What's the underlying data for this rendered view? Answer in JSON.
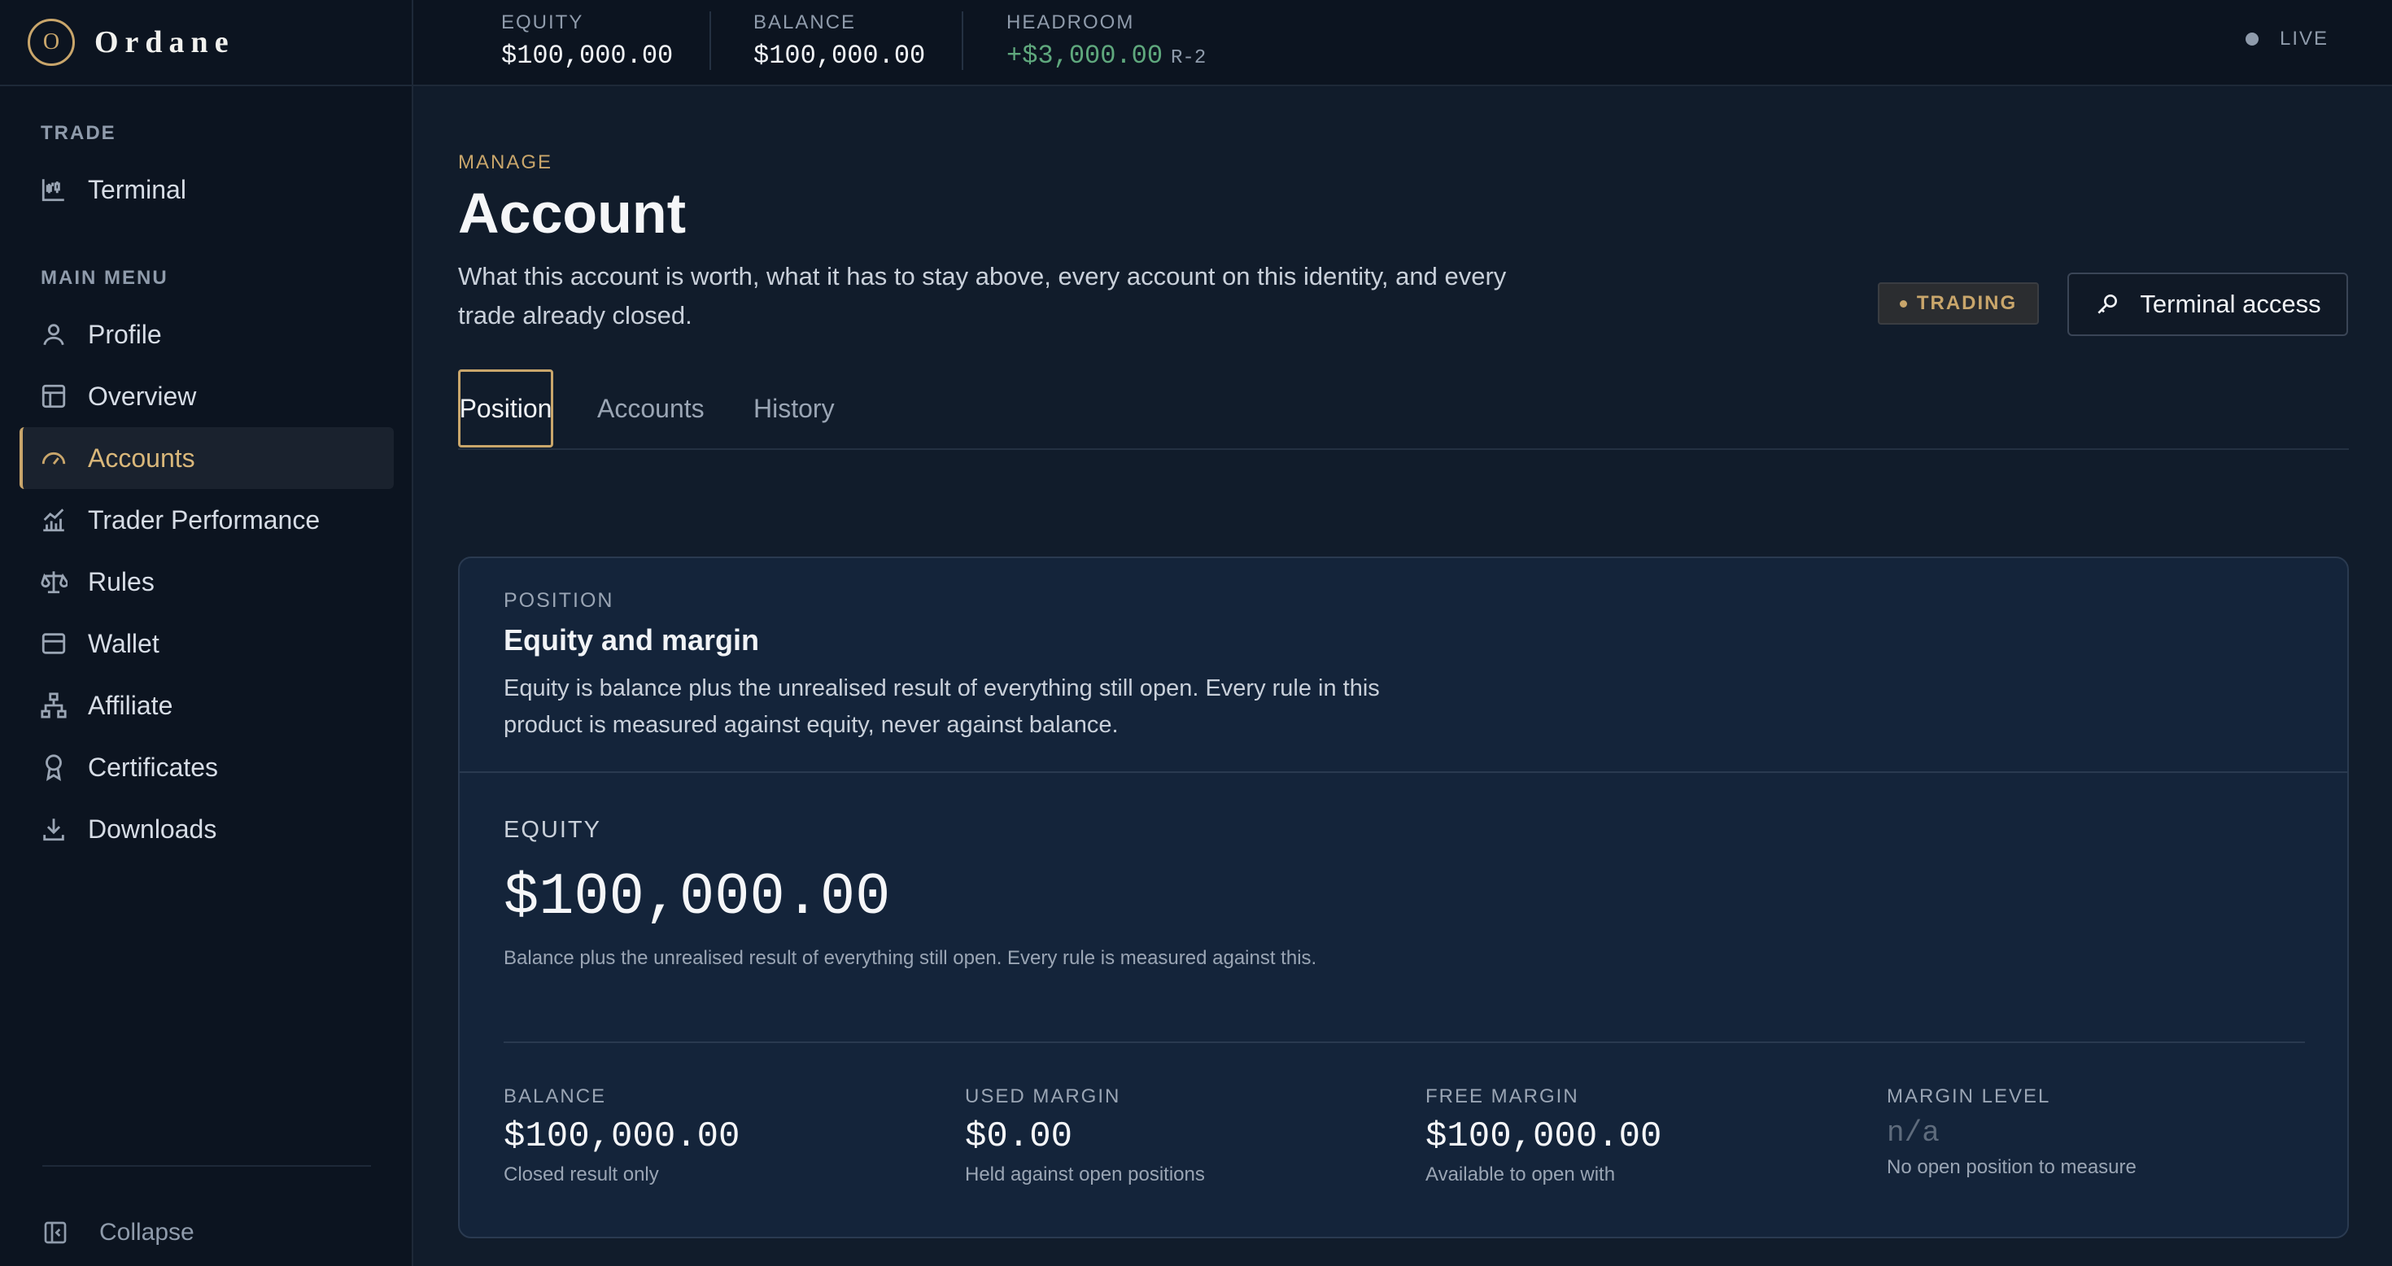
{
  "brand": {
    "logo_letter": "O",
    "name": "Ordane"
  },
  "sidebar": {
    "trade_section": "TRADE",
    "trade_items": [
      {
        "label": "Terminal",
        "icon": "candlestick-chart-icon"
      }
    ],
    "main_section": "MAIN MENU",
    "items": [
      {
        "label": "Profile",
        "icon": "user-icon"
      },
      {
        "label": "Overview",
        "icon": "layout-icon"
      },
      {
        "label": "Accounts",
        "icon": "gauge-icon",
        "active": true
      },
      {
        "label": "Trader Performance",
        "icon": "bar-chart-trend-icon"
      },
      {
        "label": "Rules",
        "icon": "scale-icon"
      },
      {
        "label": "Wallet",
        "icon": "wallet-icon"
      },
      {
        "label": "Affiliate",
        "icon": "network-icon"
      },
      {
        "label": "Certificates",
        "icon": "award-icon"
      },
      {
        "label": "Downloads",
        "icon": "download-icon"
      }
    ],
    "collapse_label": "Collapse"
  },
  "topbar": {
    "equity_label": "EQUITY",
    "equity_value": "$100,000.00",
    "balance_label": "BALANCE",
    "balance_value": "$100,000.00",
    "headroom_label": "HEADROOM",
    "headroom_value": "+$3,000.00",
    "headroom_sub": "R-2",
    "status": "LIVE"
  },
  "page": {
    "eyebrow": "MANAGE",
    "title": "Account",
    "description": "What this account is worth, what it has to stay above, every account on this identity, and every trade already closed.",
    "badge": "TRADING",
    "terminal_button": "Terminal access",
    "tabs": [
      {
        "label": "Position",
        "active": true
      },
      {
        "label": "Accounts"
      },
      {
        "label": "History"
      }
    ]
  },
  "card": {
    "eyebrow": "POSITION",
    "title": "Equity and margin",
    "description": "Equity is balance plus the unrealised result of everything still open. Every rule in this product is measured against equity, never against balance.",
    "equity_label": "EQUITY",
    "equity_value": "$100,000.00",
    "equity_note": "Balance plus the unrealised result of everything still open. Every rule is measured against this.",
    "metrics": [
      {
        "label": "BALANCE",
        "value": "$100,000.00",
        "sub": "Closed result only"
      },
      {
        "label": "USED MARGIN",
        "value": "$0.00",
        "sub": "Held against open positions"
      },
      {
        "label": "FREE MARGIN",
        "value": "$100,000.00",
        "sub": "Available to open with"
      },
      {
        "label": "MARGIN LEVEL",
        "value": "n/a",
        "sub": "No open position to measure"
      }
    ]
  },
  "colors": {
    "accent": "#c9a66b",
    "positive": "#5fa87d",
    "background": "#111c2b",
    "sidebar": "#0c1420",
    "card": "#14243a"
  }
}
